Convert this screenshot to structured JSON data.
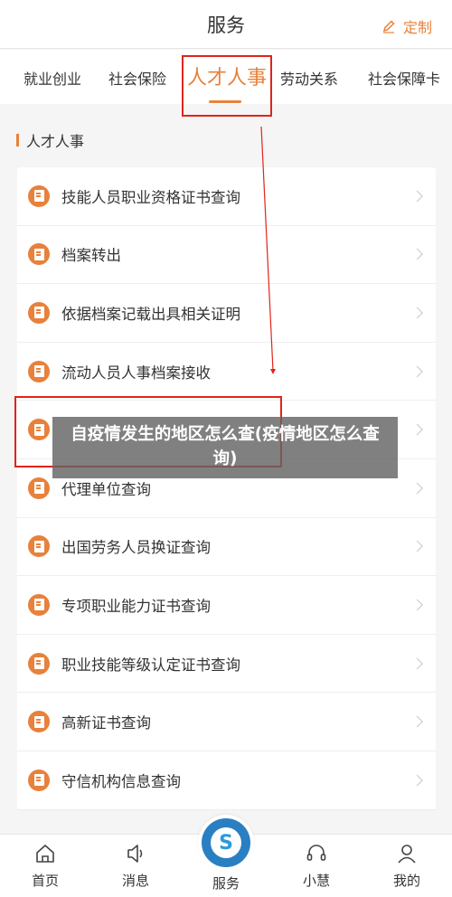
{
  "header": {
    "title": "服务",
    "customize_label": "定制"
  },
  "tabs": [
    {
      "label": "就业创业"
    },
    {
      "label": "社会保险"
    },
    {
      "label": "人才人事"
    },
    {
      "label": "劳动关系"
    },
    {
      "label": "社会保障卡"
    }
  ],
  "active_tab": "人才人事",
  "section": {
    "title": "人才人事"
  },
  "items": [
    {
      "label": "技能人员职业资格证书查询"
    },
    {
      "label": "档案转出"
    },
    {
      "label": "依据档案记载出具相关证明"
    },
    {
      "label": "流动人员人事档案接收"
    },
    {
      "label": ""
    },
    {
      "label": "代理单位查询"
    },
    {
      "label": "出国劳务人员换证查询"
    },
    {
      "label": "专项职业能力证书查询"
    },
    {
      "label": "职业技能等级认定证书查询"
    },
    {
      "label": "高新证书查询"
    },
    {
      "label": "守信机构信息查询"
    }
  ],
  "overlay": {
    "text": "自疫情发生的地区怎么查(疫情地区怎么查询)"
  },
  "bottom_nav": [
    {
      "label": "首页",
      "icon": "home-icon"
    },
    {
      "label": "消息",
      "icon": "speaker-icon"
    },
    {
      "label": "服务",
      "icon": "service-logo-icon"
    },
    {
      "label": "小慧",
      "icon": "headset-icon"
    },
    {
      "label": "我的",
      "icon": "user-icon"
    }
  ],
  "colors": {
    "accent": "#e8813b",
    "annotation_red": "#e0241b",
    "logo_blue": "#2a7fc2"
  }
}
